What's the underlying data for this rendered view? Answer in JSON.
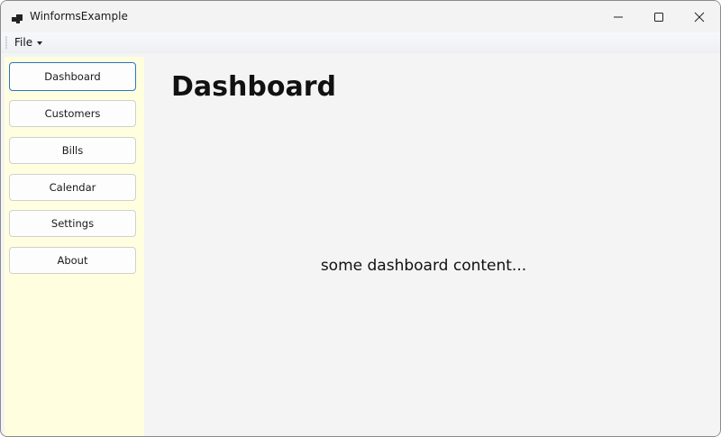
{
  "window": {
    "title": "WinformsExample"
  },
  "menu": {
    "file_label": "File"
  },
  "sidebar": {
    "background": "#ffffe0",
    "items": [
      {
        "label": "Dashboard",
        "active": true
      },
      {
        "label": "Customers",
        "active": false
      },
      {
        "label": "Bills",
        "active": false
      },
      {
        "label": "Calendar",
        "active": false
      },
      {
        "label": "Settings",
        "active": false
      },
      {
        "label": "About",
        "active": false
      }
    ]
  },
  "main": {
    "title": "Dashboard",
    "content_text": "some dashboard content..."
  },
  "colors": {
    "accent": "#2d74c4",
    "content_background": "#f4f4f4"
  },
  "icons": {
    "app": "app-icon",
    "minimize": "minimize-icon",
    "maximize": "maximize-icon",
    "close": "close-icon"
  }
}
